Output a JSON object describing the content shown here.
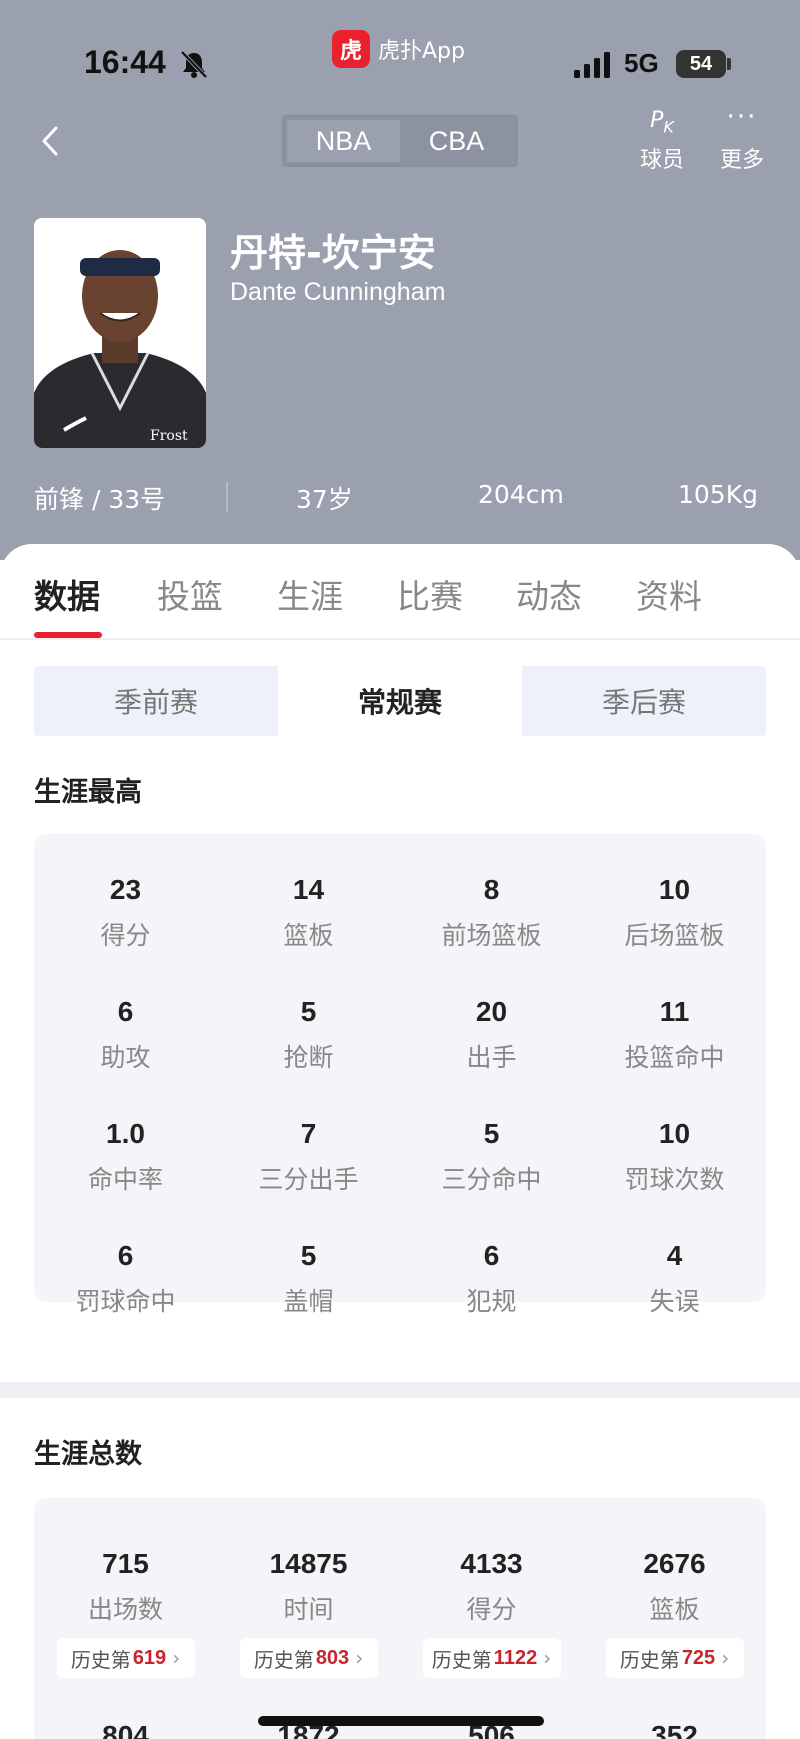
{
  "status_bar": {
    "time": "16:44",
    "app_logo_glyph": "虎",
    "app_name": "虎扑App",
    "network": "5G",
    "battery": "54"
  },
  "nav": {
    "leagues": [
      "NBA",
      "CBA"
    ],
    "active_league": "NBA",
    "pk_label": "球员",
    "pk_icon_text": "P",
    "pk_icon_sub": "K",
    "more_label": "更多",
    "more_icon_text": "···"
  },
  "player": {
    "name_cn": "丹特-坎宁安",
    "name_en": "Dante Cunningham",
    "position": "前锋 / 33号",
    "age": "37岁",
    "height": "204cm",
    "weight": "105Kg",
    "jersey_logo": "Frost"
  },
  "tabs": [
    "数据",
    "投篮",
    "生涯",
    "比赛",
    "动态",
    "资料"
  ],
  "seasons": [
    "季前赛",
    "常规赛",
    "季后赛"
  ],
  "career_high": {
    "title": "生涯最高",
    "stats": [
      {
        "value": "23",
        "label": "得分"
      },
      {
        "value": "14",
        "label": "篮板"
      },
      {
        "value": "8",
        "label": "前场篮板"
      },
      {
        "value": "10",
        "label": "后场篮板"
      },
      {
        "value": "6",
        "label": "助攻"
      },
      {
        "value": "5",
        "label": "抢断"
      },
      {
        "value": "20",
        "label": "出手"
      },
      {
        "value": "11",
        "label": "投篮命中"
      },
      {
        "value": "1.0",
        "label": "命中率"
      },
      {
        "value": "7",
        "label": "三分出手"
      },
      {
        "value": "5",
        "label": "三分命中"
      },
      {
        "value": "10",
        "label": "罚球次数"
      },
      {
        "value": "6",
        "label": "罚球命中"
      },
      {
        "value": "5",
        "label": "盖帽"
      },
      {
        "value": "6",
        "label": "犯规"
      },
      {
        "value": "4",
        "label": "失误"
      }
    ]
  },
  "career_total": {
    "title": "生涯总数",
    "rank_prefix": "历史第",
    "stats": [
      {
        "value": "715",
        "label": "出场数",
        "rank": "619"
      },
      {
        "value": "14875",
        "label": "时间",
        "rank": "803"
      },
      {
        "value": "4133",
        "label": "得分",
        "rank": "1122"
      },
      {
        "value": "2676",
        "label": "篮板",
        "rank": "725"
      }
    ],
    "next_row_partial": [
      "804",
      "1872",
      "506",
      "352"
    ]
  }
}
